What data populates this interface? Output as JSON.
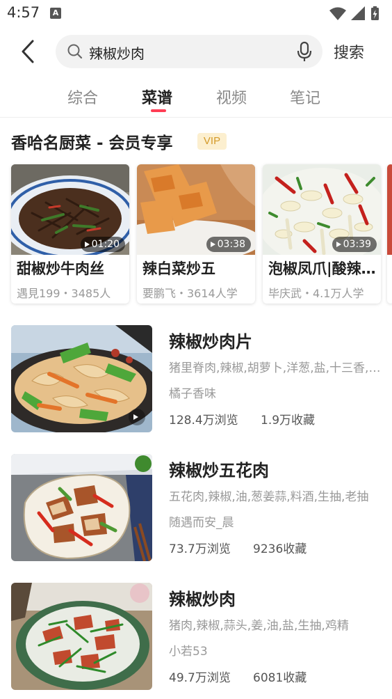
{
  "status_bar": {
    "time": "4:57",
    "notification_icon": "A"
  },
  "search": {
    "query": "辣椒炒肉",
    "button_label": "搜索"
  },
  "tabs": [
    {
      "label": "综合",
      "active": false
    },
    {
      "label": "菜谱",
      "active": true
    },
    {
      "label": "视频",
      "active": false
    },
    {
      "label": "笔记",
      "active": false
    }
  ],
  "section": {
    "title": "香哈名厨菜 - 会员专享",
    "badge": "VIP"
  },
  "cards": [
    {
      "title": "甜椒炒牛肉丝",
      "duration": "01:20",
      "meta": "遇見199・3485人"
    },
    {
      "title": "辣白菜炒五",
      "duration": "03:38",
      "meta": "要鹏飞・3614人学"
    },
    {
      "title": "泡椒凤爪|酸辣开胃",
      "duration": "03:39",
      "meta": "毕庆武・4.1万人学"
    }
  ],
  "recipes": [
    {
      "title": "辣椒炒肉片",
      "ingredients": "猪里脊肉,辣椒,胡萝卜,洋葱,盐,十三香,生抽",
      "author": "橘子香味",
      "views": "128.4万浏览",
      "favorites": "1.9万收藏"
    },
    {
      "title": "辣椒炒五花肉",
      "ingredients": "五花肉,辣椒,油,葱姜蒜,料酒,生抽,老抽",
      "author": "随遇而安_晨",
      "views": "73.7万浏览",
      "favorites": "9236收藏"
    },
    {
      "title": "辣椒炒肉",
      "ingredients": "猪肉,辣椒,蒜头,姜,油,盐,生抽,鸡精",
      "author": "小若53",
      "views": "49.7万浏览",
      "favorites": "6081收藏"
    }
  ],
  "colors": {
    "accent": "#ff3e55",
    "vip_bg": "#fcefcf",
    "vip_text": "#d49a2a"
  }
}
